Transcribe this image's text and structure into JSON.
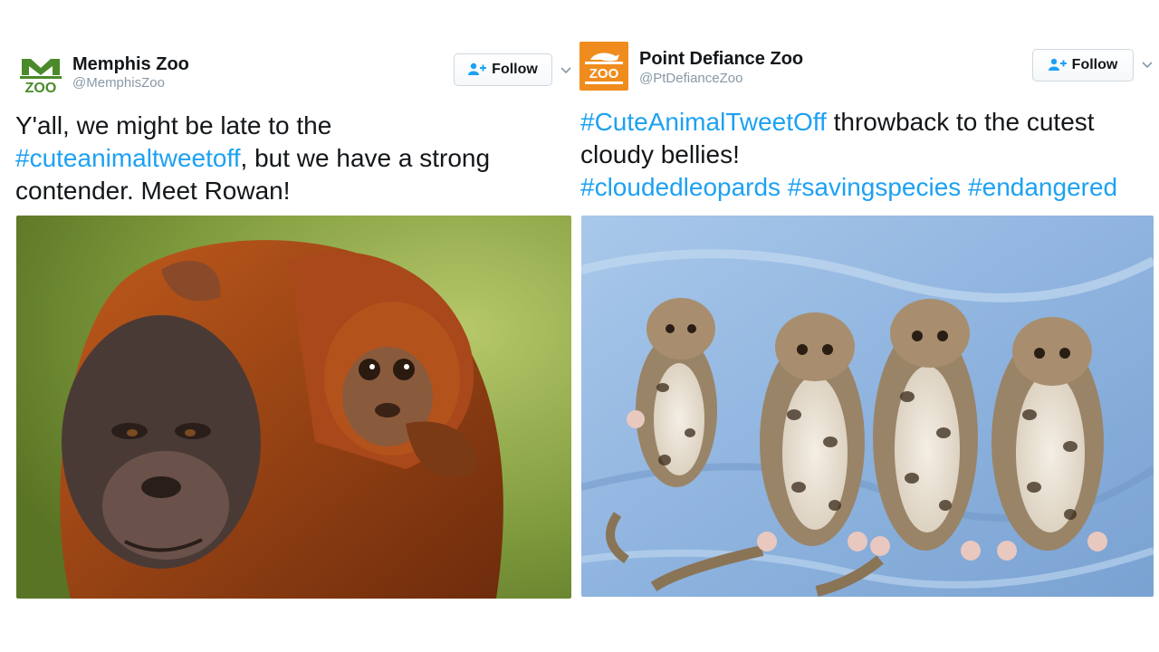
{
  "tweets": [
    {
      "name": "Memphis Zoo",
      "handle": "@MemphisZoo",
      "follow_label": "Follow",
      "text_parts": [
        "Y'all, we might be late to the ",
        "#cuteanimaltweetoff",
        ", but we have a strong contender. Meet Rowan!"
      ],
      "logo_text": "ZOO",
      "accent": "#4a8a2a"
    },
    {
      "name": "Point Defiance Zoo",
      "handle": "@PtDefianceZoo",
      "follow_label": "Follow",
      "text_parts": [
        "#CuteAnimalTweetOff",
        " throwback to the cutest cloudy bellies!",
        "#cloudedleopards #savingspecies #endangered"
      ],
      "logo_text": "ZOO",
      "accent": "#f08c1e"
    }
  ],
  "colors": {
    "link": "#1da1f2",
    "text": "#14171a",
    "muted": "#8899a6"
  }
}
